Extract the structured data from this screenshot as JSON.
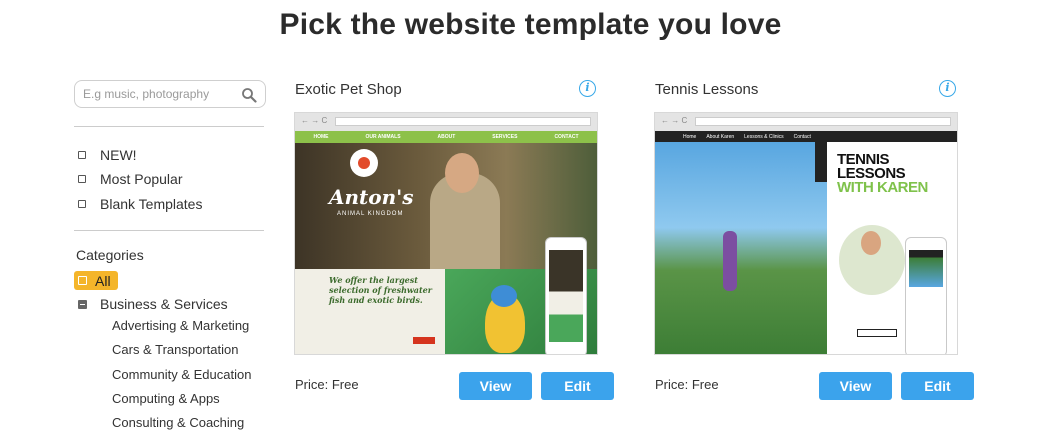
{
  "page_title": "Pick the website template you love",
  "sidebar": {
    "search_placeholder": "E.g music, photography",
    "filters": [
      {
        "label": "NEW!"
      },
      {
        "label": "Most Popular"
      },
      {
        "label": "Blank Templates"
      }
    ],
    "categories_heading": "Categories",
    "category_all": "All",
    "category_expanded": "Business & Services",
    "subcategories": [
      "Advertising & Marketing",
      "Cars & Transportation",
      "Community & Education",
      "Computing & Apps",
      "Consulting & Coaching"
    ]
  },
  "templates": [
    {
      "title": "Exotic Pet Shop",
      "price": "Price: Free",
      "view_label": "View",
      "edit_label": "Edit",
      "preview": {
        "nav": [
          "HOME",
          "OUR ANIMALS",
          "ABOUT",
          "SERVICES",
          "CONTACT"
        ],
        "logo": "Anton's",
        "logo_sub": "ANIMAL KINGDOM",
        "tagline": "We offer the largest selection of freshwater fish and exotic birds."
      }
    },
    {
      "title": "Tennis Lessons",
      "price": "Price: Free",
      "view_label": "View",
      "edit_label": "Edit",
      "preview": {
        "nav": [
          "Home",
          "About Karen",
          "Lessons & Clinics",
          "Contact"
        ],
        "headline": "TENNIS LESSONS",
        "headline_accent": "WITH KAREN"
      }
    }
  ],
  "colors": {
    "accent_button": "#3ba3ec",
    "selected_category": "#f4b52a",
    "info_icon": "#38a8e8"
  }
}
